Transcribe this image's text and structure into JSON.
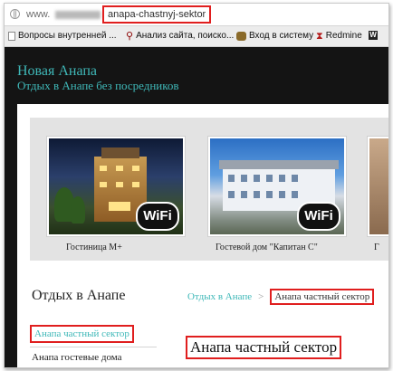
{
  "browser": {
    "url_prefix": "www.",
    "url_slug": "anapa-chastnyj-sektor"
  },
  "bookmarks": [
    {
      "label": "Вопросы внутренней ...",
      "icon": "page-icon"
    },
    {
      "label": "Анализ сайта, поиско...",
      "icon": "magnifier-icon"
    },
    {
      "label": "Вход в систему",
      "icon": "cat-icon"
    },
    {
      "label": "Redmine",
      "icon": "redmine-icon"
    },
    {
      "label": "",
      "icon": "wikipedia-icon"
    }
  ],
  "site": {
    "title": "Новая Анапа",
    "tagline": "Отдых в Анапе без посредников"
  },
  "slider": {
    "slides": [
      {
        "caption": "Гостиница М+",
        "badge": "WiFi"
      },
      {
        "caption": "Гостевой дом \"Капитан С\"",
        "badge": "WiFi"
      },
      {
        "caption": "Г",
        "badge": ""
      }
    ]
  },
  "sidebar": {
    "heading": "Отдых в Анапе",
    "items": [
      {
        "label": "Анапа частный сектор",
        "active": true
      },
      {
        "label": "Анапа гостевые дома",
        "active": false
      }
    ]
  },
  "breadcrumb": {
    "link": "Отдых в Анапе",
    "separator": ">",
    "current": "Анапа частный сектор"
  },
  "page": {
    "title": "Анапа частный сектор"
  },
  "colors": {
    "accent": "#3fb8b8",
    "highlight": "#e01e1e",
    "header_bg": "#141414"
  }
}
